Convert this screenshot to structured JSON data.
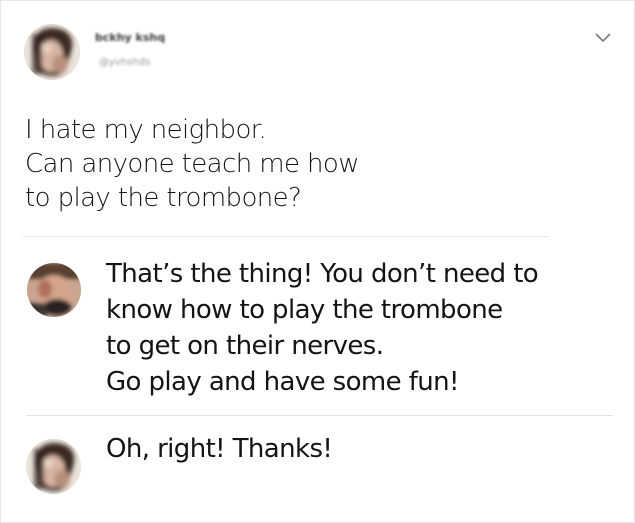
{
  "post": {
    "author_display_name": "bckhy kshq",
    "author_handle": "@yvhshds",
    "menu_icon": "chevron-down-icon",
    "text_lines": [
      "I hate my neighbor.",
      "Can anyone teach me how",
      "to play the trombone?"
    ]
  },
  "replies": [
    {
      "text_lines": [
        "That’s the thing! You don’t need to",
        "know how to play the trombone",
        "to get on their nerves.",
        "Go play and have some fun!"
      ]
    },
    {
      "text_lines": [
        "Oh, right! Thanks!"
      ]
    }
  ],
  "colors": {
    "background": "#ffffff",
    "text": "#141414",
    "divider": "#e3e3e3",
    "chevron": "#7a7a7a"
  }
}
